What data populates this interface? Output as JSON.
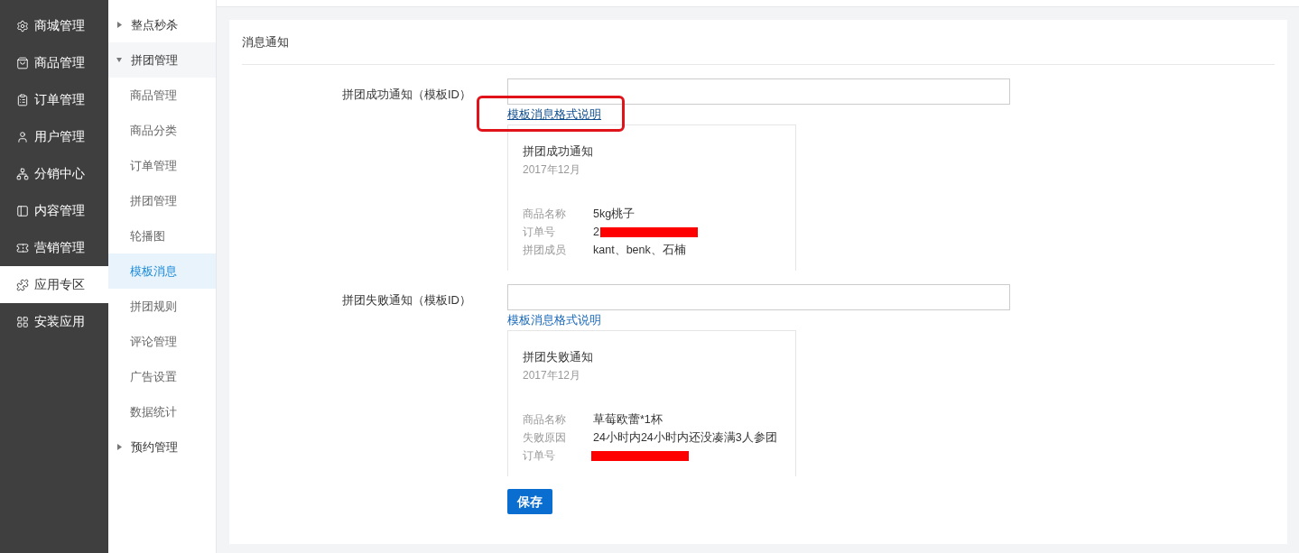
{
  "main_nav": [
    {
      "label": "商城管理",
      "selected": false
    },
    {
      "label": "商品管理",
      "selected": false
    },
    {
      "label": "订单管理",
      "selected": false
    },
    {
      "label": "用户管理",
      "selected": false
    },
    {
      "label": "分销中心",
      "selected": false
    },
    {
      "label": "内容管理",
      "selected": false
    },
    {
      "label": "营销管理",
      "selected": false
    },
    {
      "label": "应用专区",
      "selected": true
    },
    {
      "label": "安装应用",
      "selected": false
    }
  ],
  "sub_nav": [
    {
      "label": "整点秒杀",
      "expanded": false
    },
    {
      "label": "拼团管理",
      "expanded": true,
      "children": [
        {
          "label": "商品管理",
          "selected": false
        },
        {
          "label": "商品分类",
          "selected": false
        },
        {
          "label": "订单管理",
          "selected": false
        },
        {
          "label": "拼团管理",
          "selected": false
        },
        {
          "label": "轮播图",
          "selected": false
        },
        {
          "label": "模板消息",
          "selected": true
        },
        {
          "label": "拼团规则",
          "selected": false
        },
        {
          "label": "评论管理",
          "selected": false
        },
        {
          "label": "广告设置",
          "selected": false
        },
        {
          "label": "数据统计",
          "selected": false
        }
      ]
    },
    {
      "label": "预约管理",
      "expanded": false
    }
  ],
  "panel": {
    "title": "消息通知",
    "fields": [
      {
        "label": "拼团成功通知（模板ID）",
        "link": "模板消息格式说明",
        "highlighted": true,
        "preview": {
          "title": "拼团成功通知",
          "date": "2017年12月",
          "rows": [
            {
              "name": "商品名称",
              "value": "5kg桃子",
              "redacted": false
            },
            {
              "name": "订单号",
              "value": "2",
              "redacted": true
            },
            {
              "name": "拼团成员",
              "value": "kant、benk、石楠",
              "redacted": false
            }
          ]
        }
      },
      {
        "label": "拼团失败通知（模板ID）",
        "link": "模板消息格式说明",
        "highlighted": false,
        "preview": {
          "title": "拼团失败通知",
          "date": "2017年12月",
          "rows": [
            {
              "name": "商品名称",
              "value": "草莓欧蕾*1杯",
              "redacted": false
            },
            {
              "name": "失败原因",
              "value": "24小时内24小时内还没凑满3人参团",
              "redacted": false
            },
            {
              "name": "订单号",
              "redacted": true
            }
          ]
        }
      }
    ],
    "save_button": "保存"
  }
}
